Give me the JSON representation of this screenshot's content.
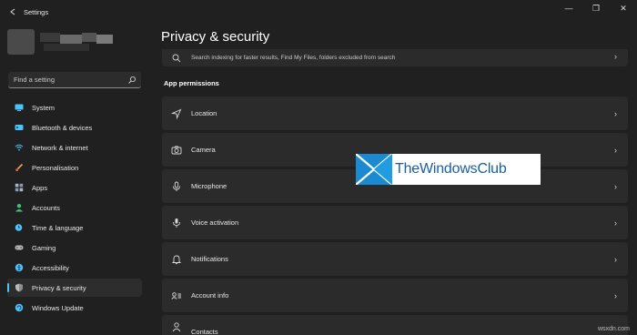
{
  "window": {
    "title": "Settings",
    "controls": [
      "—",
      "❐",
      "✕"
    ]
  },
  "search": {
    "placeholder": "Find a setting"
  },
  "sidebar": {
    "items": [
      {
        "label": "System",
        "icon": "monitor-icon",
        "color": "#4cc2ff"
      },
      {
        "label": "Bluetooth & devices",
        "icon": "bluetooth-icon",
        "color": "#4cc2ff"
      },
      {
        "label": "Network & internet",
        "icon": "wifi-icon",
        "color": "#4cc2ff"
      },
      {
        "label": "Personalisation",
        "icon": "brush-icon",
        "color": "#e8a25a"
      },
      {
        "label": "Apps",
        "icon": "apps-icon",
        "color": "#a8b4c8"
      },
      {
        "label": "Accounts",
        "icon": "person-icon",
        "color": "#3fc07a"
      },
      {
        "label": "Time & language",
        "icon": "globe-clock-icon",
        "color": "#4cc2ff"
      },
      {
        "label": "Gaming",
        "icon": "controller-icon",
        "color": "#b8b8b8"
      },
      {
        "label": "Accessibility",
        "icon": "accessibility-icon",
        "color": "#4cc2ff"
      },
      {
        "label": "Privacy & security",
        "icon": "shield-icon",
        "color": "#b8b8b8",
        "selected": true
      },
      {
        "label": "Windows Update",
        "icon": "update-icon",
        "color": "#4cc2ff"
      }
    ]
  },
  "main": {
    "title": "Privacy & security",
    "partial_card_desc": "Search indexing for faster results, Find My Files, folders excluded from search",
    "section_header": "App permissions",
    "permissions": [
      {
        "label": "Location",
        "icon": "location-icon"
      },
      {
        "label": "Camera",
        "icon": "camera-icon"
      },
      {
        "label": "Microphone",
        "icon": "microphone-icon"
      },
      {
        "label": "Voice activation",
        "icon": "voice-activation-icon"
      },
      {
        "label": "Notifications",
        "icon": "bell-icon"
      },
      {
        "label": "Account info",
        "icon": "account-info-icon"
      },
      {
        "label": "Contacts",
        "icon": "contacts-icon"
      }
    ]
  },
  "watermark": {
    "text": "TheWindowsClub"
  },
  "site_tag": "wsxdn.com",
  "colors": {
    "accent": "#4cc2ff",
    "background": "#202020",
    "card": "#2b2b2b"
  }
}
